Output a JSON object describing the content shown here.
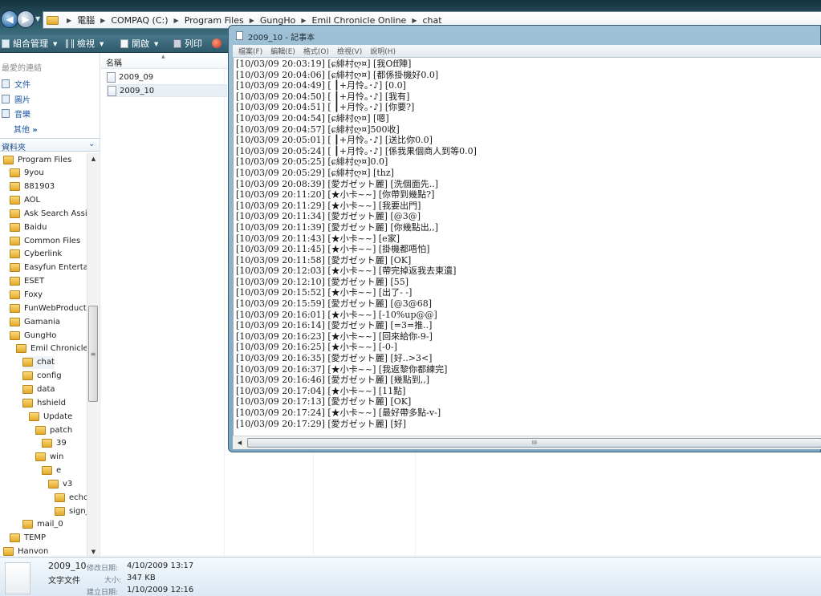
{
  "address_bar": {
    "crumbs": [
      "電腦",
      "COMPAQ (C:)",
      "Program Files",
      "GungHo",
      "Emil Chronicle Online",
      "chat"
    ]
  },
  "toolbar": {
    "organize_label": "組合管理",
    "views_label": "檢視",
    "open_label": "開啟",
    "print_label": "列印"
  },
  "nav_pane": {
    "favorites_heading": "最愛的連結",
    "favorites": [
      "文件",
      "圖片",
      "音樂"
    ],
    "more_label": "其他",
    "more_glyph": "»",
    "folders_label": "資料夾",
    "tree": [
      "Program Files",
      "9you",
      "881903",
      "AOL",
      "Ask Search Assista",
      "Baidu",
      "Common Files",
      "Cyberlink",
      "Easyfun Entertain",
      "ESET",
      "Foxy",
      "FunWebProducts",
      "Gamania",
      "GungHo",
      "Emil Chronicle O",
      "chat",
      "config",
      "data",
      "hshield",
      "Update",
      "patch",
      "39",
      "win",
      "e",
      "v3",
      "echo",
      "sign_",
      "mail_0",
      "TEMP",
      "Hanvon"
    ],
    "selected_folder": "chat"
  },
  "file_list": {
    "column_name": "名稱",
    "files": [
      "2009_09",
      "2009_10"
    ],
    "selected_file": "2009_10"
  },
  "details": {
    "filename": "2009_10",
    "file_type": "文字文件",
    "modified_label": "修改日期:",
    "modified_value": "4/10/2009 13:17",
    "size_label": "大小:",
    "size_value": "347 KB",
    "created_label": "建立日期:",
    "created_value": "1/10/2009 12:16"
  },
  "notepad": {
    "title": "2009_10 - 記事本",
    "menus": [
      "檔案(F)",
      "編輯(E)",
      "格式(O)",
      "檢視(V)",
      "說明(H)"
    ],
    "lines": [
      "[10/03/09 20:03:19] [ɕ緋村ღ¤] [我Off陣]",
      "[10/03/09 20:04:06] [ɕ緋村ღ¤] [都係掛機好0.0]",
      "[10/03/09 20:04:49] [ ┃+月怜｡･♪] [0.0]",
      "[10/03/09 20:04:50] [ ┃+月怜｡･♪] [我有]",
      "[10/03/09 20:04:51] [ ┃+月怜｡･♪] [你要?]",
      "[10/03/09 20:04:54] [ɕ緋村ღ¤] [嗯]",
      "[10/03/09 20:04:57] [ɕ緋村ღ¤]500收]",
      "[10/03/09 20:05:01] [ ┃+月怜｡･♪] [送比你0.0]",
      "[10/03/09 20:05:24] [ ┃+月怜｡･♪] [係我果個商人到等0.0]",
      "[10/03/09 20:05:25] [ɕ緋村ღ¤]0.0]",
      "[10/03/09 20:05:29] [ɕ緋村ღ¤] [thz]",
      "[10/03/09 20:08:39] [愛ガゼット麗] [洗個面先..]",
      "[10/03/09 20:11:20] [★小卡~~] [你帶到幾點?]",
      "[10/03/09 20:11:29] [★小卡~~] [我要出門]",
      "[10/03/09 20:11:34] [愛ガゼット麗] [@3@]",
      "[10/03/09 20:11:39] [愛ガゼット麗] [你幾點出,,]",
      "[10/03/09 20:11:43] [★小卡~~] [e家]",
      "[10/03/09 20:11:45] [★小卡~~] [掛機都唔怕]",
      "[10/03/09 20:11:58] [愛ガゼット麗] [OK]",
      "[10/03/09 20:12:03] [★小卡~~] [帶完掉返我去東遺]",
      "[10/03/09 20:12:10] [愛ガゼット麗] [55]",
      "[10/03/09 20:15:52] [★小卡~~] [出了- -]",
      "[10/03/09 20:15:59] [愛ガゼット麗] [@3@68]",
      "[10/03/09 20:16:01] [★小卡~~] [-10%up@@]",
      "[10/03/09 20:16:14] [愛ガゼット麗] [=3=推..]",
      "[10/03/09 20:16:23] [★小卡~~] [回來給你-9-]",
      "[10/03/09 20:16:25] [★小卡~~] [-0-]",
      "[10/03/09 20:16:35] [愛ガゼット麗] [好..>3<]",
      "[10/03/09 20:16:37] [★小卡~~] [我返黎你都練完]",
      "[10/03/09 20:16:46] [愛ガゼット麗] [幾點到,,]",
      "[10/03/09 20:17:04] [★小卡~~] [11點]",
      "[10/03/09 20:17:13] [愛ガゼット麗] [OK]",
      "[10/03/09 20:17:24] [★小卡~~] [最好帶多點-v-]",
      "[10/03/09 20:17:29] [愛ガゼット麗] [好]"
    ],
    "scroll_grip": "III"
  },
  "scroll_glyphs": {
    "up": "▲",
    "down": "▼",
    "left": "◀",
    "grip": "≡"
  },
  "colors": {
    "address_bg": "#2d5868",
    "toolbar_bg": "#3c6a7c",
    "link": "#1a57a3",
    "folder": "#e3a92a"
  }
}
